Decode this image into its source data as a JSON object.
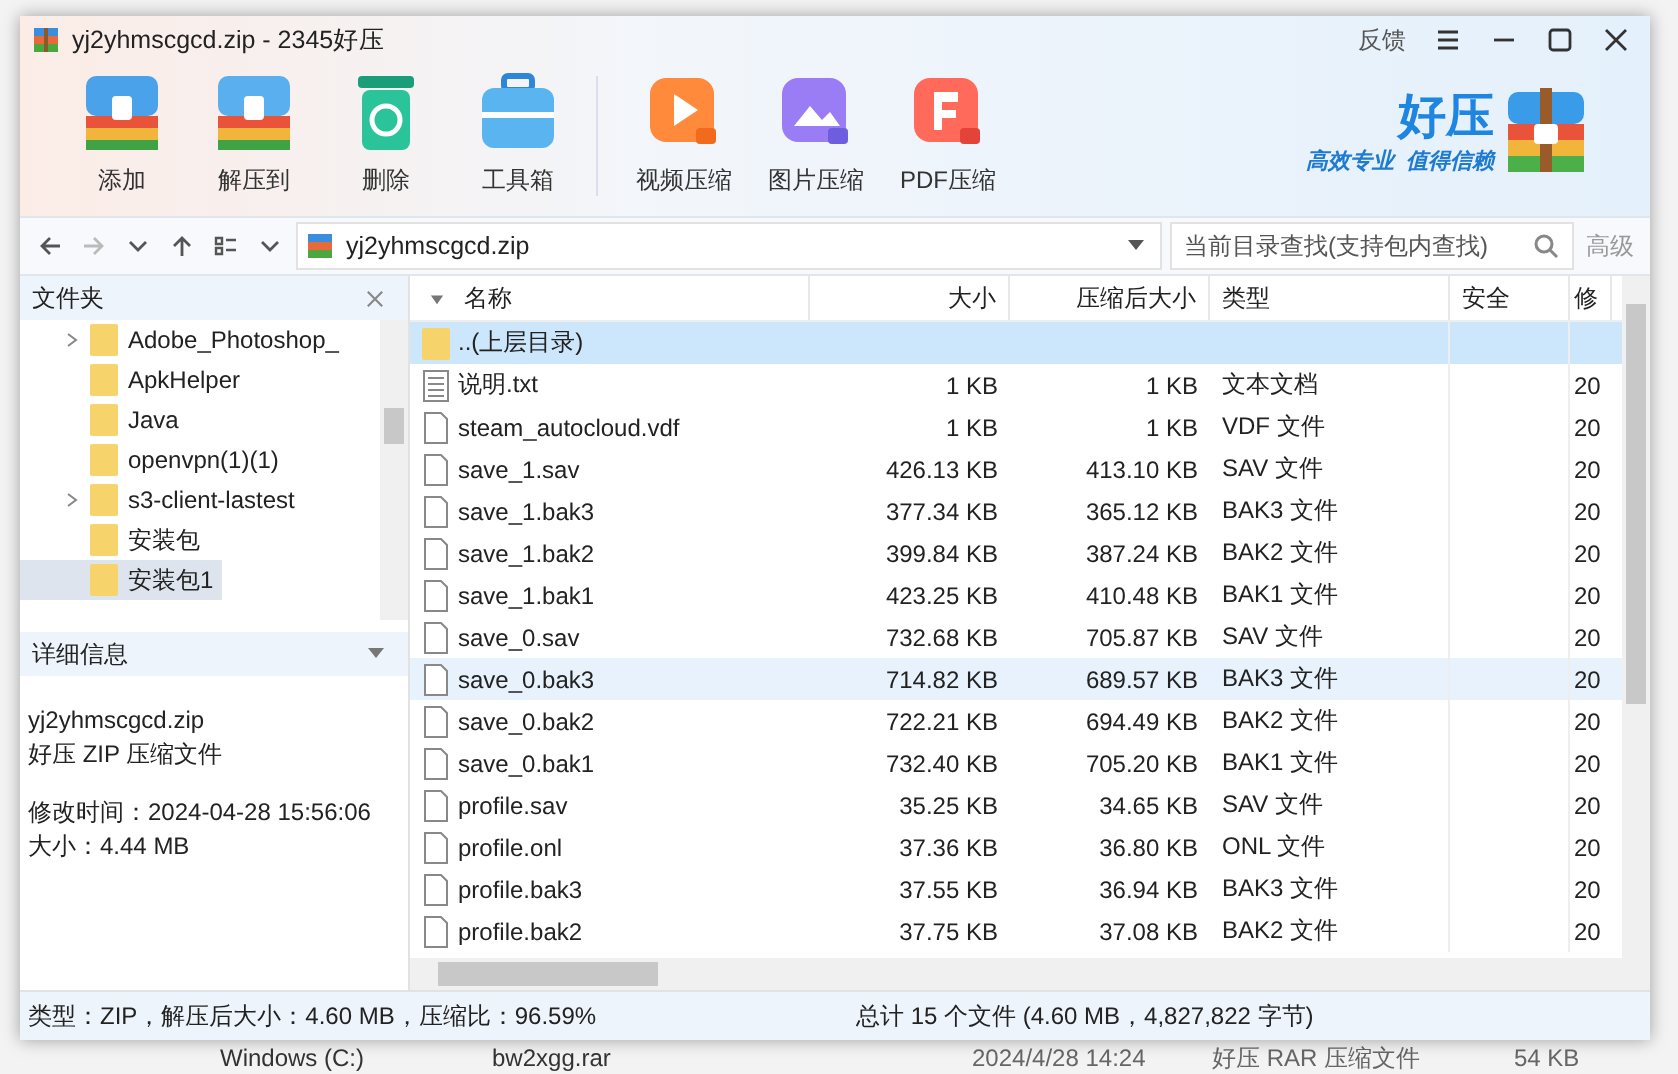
{
  "window": {
    "title": "yj2yhmscgcd.zip - 2345好压",
    "feedback": "反馈"
  },
  "toolbar": [
    {
      "label": "添加",
      "kind": "add"
    },
    {
      "label": "解压到",
      "kind": "extract"
    },
    {
      "label": "删除",
      "kind": "delete"
    },
    {
      "label": "工具箱",
      "kind": "toolbox"
    },
    {
      "label": "视频压缩",
      "kind": "video"
    },
    {
      "label": "图片压缩",
      "kind": "image"
    },
    {
      "label": "PDF压缩",
      "kind": "pdf"
    }
  ],
  "logo": {
    "name": "好压",
    "slogan_1": "高效专业",
    "slogan_2": "值得信赖"
  },
  "address": {
    "path": "yj2yhmscgcd.zip",
    "search_placeholder": "当前目录查找(支持包内查找)",
    "advanced": "高级"
  },
  "folders": {
    "title": "文件夹",
    "items": [
      {
        "name": "Adobe_Photoshop_",
        "has_children": true,
        "selected": false
      },
      {
        "name": "ApkHelper",
        "has_children": false,
        "selected": false
      },
      {
        "name": "Java",
        "has_children": false,
        "selected": false
      },
      {
        "name": "openvpn(1)(1)",
        "has_children": false,
        "selected": false
      },
      {
        "name": "s3-client-lastest",
        "has_children": true,
        "selected": false
      },
      {
        "name": "安装包",
        "has_children": false,
        "selected": false
      },
      {
        "name": "安装包1",
        "has_children": false,
        "selected": true
      }
    ]
  },
  "details": {
    "title": "详细信息",
    "file_lines": [
      "yj2yhmscgcd.zip",
      "好压 ZIP 压缩文件"
    ],
    "info_lines": [
      "修改时间：2024-04-28 15:56:06",
      "大小：4.44 MB"
    ]
  },
  "table": {
    "columns": [
      "名称",
      "大小",
      "压缩后大小",
      "类型",
      "安全",
      "修"
    ],
    "rows": [
      {
        "kind": "parent",
        "name": "..(上层目录)",
        "selected": true,
        "hovered": false
      },
      {
        "kind": "text",
        "name": "说明.txt",
        "size": "1 KB",
        "packed": "1 KB",
        "type": "文本文档",
        "modified": "20",
        "selected": false,
        "hovered": false
      },
      {
        "kind": "file",
        "name": "steam_autocloud.vdf",
        "size": "1 KB",
        "packed": "1 KB",
        "type": "VDF 文件",
        "modified": "20",
        "selected": false,
        "hovered": false
      },
      {
        "kind": "file",
        "name": "save_1.sav",
        "size": "426.13 KB",
        "packed": "413.10 KB",
        "type": "SAV 文件",
        "modified": "20",
        "selected": false,
        "hovered": false
      },
      {
        "kind": "file",
        "name": "save_1.bak3",
        "size": "377.34 KB",
        "packed": "365.12 KB",
        "type": "BAK3 文件",
        "modified": "20",
        "selected": false,
        "hovered": false
      },
      {
        "kind": "file",
        "name": "save_1.bak2",
        "size": "399.84 KB",
        "packed": "387.24 KB",
        "type": "BAK2 文件",
        "modified": "20",
        "selected": false,
        "hovered": false
      },
      {
        "kind": "file",
        "name": "save_1.bak1",
        "size": "423.25 KB",
        "packed": "410.48 KB",
        "type": "BAK1 文件",
        "modified": "20",
        "selected": false,
        "hovered": false
      },
      {
        "kind": "file",
        "name": "save_0.sav",
        "size": "732.68 KB",
        "packed": "705.87 KB",
        "type": "SAV 文件",
        "modified": "20",
        "selected": false,
        "hovered": false
      },
      {
        "kind": "file",
        "name": "save_0.bak3",
        "size": "714.82 KB",
        "packed": "689.57 KB",
        "type": "BAK3 文件",
        "modified": "20",
        "selected": false,
        "hovered": true
      },
      {
        "kind": "file",
        "name": "save_0.bak2",
        "size": "722.21 KB",
        "packed": "694.49 KB",
        "type": "BAK2 文件",
        "modified": "20",
        "selected": false,
        "hovered": false
      },
      {
        "kind": "file",
        "name": "save_0.bak1",
        "size": "732.40 KB",
        "packed": "705.20 KB",
        "type": "BAK1 文件",
        "modified": "20",
        "selected": false,
        "hovered": false
      },
      {
        "kind": "file",
        "name": "profile.sav",
        "size": "35.25 KB",
        "packed": "34.65 KB",
        "type": "SAV 文件",
        "modified": "20",
        "selected": false,
        "hovered": false
      },
      {
        "kind": "file",
        "name": "profile.onl",
        "size": "37.36 KB",
        "packed": "36.80 KB",
        "type": "ONL 文件",
        "modified": "20",
        "selected": false,
        "hovered": false
      },
      {
        "kind": "file",
        "name": "profile.bak3",
        "size": "37.55 KB",
        "packed": "36.94 KB",
        "type": "BAK3 文件",
        "modified": "20",
        "selected": false,
        "hovered": false
      },
      {
        "kind": "file",
        "name": "profile.bak2",
        "size": "37.75 KB",
        "packed": "37.08 KB",
        "type": "BAK2 文件",
        "modified": "20",
        "selected": false,
        "hovered": false
      }
    ]
  },
  "status_bar": {
    "left": "类型：ZIP，解压后大小：4.60 MB，压缩比：96.59%",
    "right": "总计 15 个文件 (4.60 MB，4,827,822 字节)"
  },
  "background_row": {
    "drive": "Windows (C:)",
    "file": "bw2xgg.rar",
    "date": "2024/4/28 14:24",
    "type": "好压 RAR 压缩文件",
    "size": "54 KB"
  }
}
